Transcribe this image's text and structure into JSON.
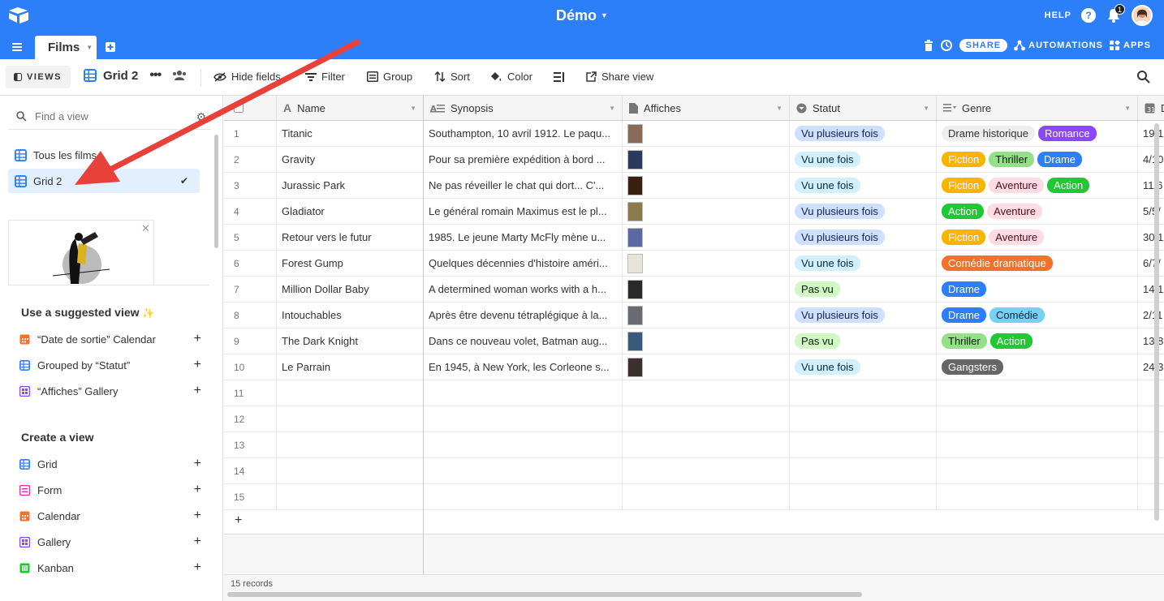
{
  "app": {
    "base_name": "Démo"
  },
  "top_right": {
    "help": "HELP",
    "help_icon": "?",
    "notif_count": "1"
  },
  "tabs": {
    "table_name": "Films",
    "share": "SHARE",
    "automations": "AUTOMATIONS",
    "apps": "APPS"
  },
  "toolbar": {
    "views": "VIEWS",
    "view_name": "Grid 2",
    "hide_fields": "Hide fields",
    "filter": "Filter",
    "group": "Group",
    "sort": "Sort",
    "color": "Color",
    "share_view": "Share view"
  },
  "sidebar": {
    "find_placeholder": "Find a view",
    "views": [
      {
        "label": "Tous les films"
      },
      {
        "label": "Grid 2"
      }
    ],
    "suggested_title": "Use a suggested view",
    "suggested": [
      {
        "label": "“Date de sortie” Calendar",
        "icon": "calendar-icon",
        "color": "#f2722c"
      },
      {
        "label": "Grouped by “Statut”",
        "icon": "grid-icon",
        "color": "#2d7ff9"
      },
      {
        "label": "“Affiches” Gallery",
        "icon": "gallery-icon",
        "color": "#8b46ff"
      }
    ],
    "create_title": "Create a view",
    "create": [
      {
        "label": "Grid",
        "icon": "grid-icon",
        "color": "#2d7ff9"
      },
      {
        "label": "Form",
        "icon": "form-icon",
        "color": "#e929ba"
      },
      {
        "label": "Calendar",
        "icon": "calendar-icon",
        "color": "#f2722c"
      },
      {
        "label": "Gallery",
        "icon": "gallery-icon",
        "color": "#8b46ff"
      },
      {
        "label": "Kanban",
        "icon": "kanban-icon",
        "color": "#20c933"
      }
    ]
  },
  "grid": {
    "headers": [
      "Name",
      "Synopsis",
      "Affiches",
      "Statut",
      "Genre",
      "D"
    ],
    "rows": [
      {
        "num": "1",
        "name": "Titanic",
        "synopsis": "Southampton, 10 avril 1912. Le paqu...",
        "statut": "Vu plusieurs fois",
        "genre": [
          "Drame historique",
          "Romance"
        ],
        "date": "19/1"
      },
      {
        "num": "2",
        "name": "Gravity",
        "synopsis": "Pour sa première expédition à bord ...",
        "statut": "Vu une fois",
        "genre": [
          "Fiction",
          "Thriller",
          "Drame"
        ],
        "date": "4/10"
      },
      {
        "num": "3",
        "name": "Jurassic Park",
        "synopsis": "Ne pas réveiller le chat qui dort... C'...",
        "statut": "Vu une fois",
        "genre": [
          "Fiction",
          "Aventure",
          "Action"
        ],
        "date": "11/6"
      },
      {
        "num": "4",
        "name": "Gladiator",
        "synopsis": "Le général romain Maximus est le pl...",
        "statut": "Vu plusieurs fois",
        "genre": [
          "Action",
          "Aventure"
        ],
        "date": "5/5/"
      },
      {
        "num": "5",
        "name": "Retour vers le futur",
        "synopsis": "1985. Le jeune Marty McFly mène u...",
        "statut": "Vu plusieurs fois",
        "genre": [
          "Fiction",
          "Aventure"
        ],
        "date": "30/1"
      },
      {
        "num": "6",
        "name": "Forest Gump",
        "synopsis": "Quelques décennies d'histoire améri...",
        "statut": "Vu une fois",
        "genre": [
          "Comédie dramatique"
        ],
        "date": "6/7/"
      },
      {
        "num": "7",
        "name": "Million Dollar Baby",
        "synopsis": "A determined woman works with a h...",
        "statut": "Pas vu",
        "genre": [
          "Drame"
        ],
        "date": "14/1"
      },
      {
        "num": "8",
        "name": "Intouchables",
        "synopsis": "Après être devenu tétraplégique à la...",
        "statut": "Vu plusieurs fois",
        "genre": [
          "Drame",
          "Comédie"
        ],
        "date": "2/11"
      },
      {
        "num": "9",
        "name": "The Dark Knight",
        "synopsis": "Dans ce nouveau volet, Batman aug...",
        "statut": "Pas vu",
        "genre": [
          "Thriller",
          "Action"
        ],
        "date": "13/8"
      },
      {
        "num": "10",
        "name": "Le Parrain",
        "synopsis": "En 1945, à New York, les Corleone s...",
        "statut": "Vu une fois",
        "genre": [
          "Gangsters"
        ],
        "date": "24/3"
      },
      {
        "num": "11"
      },
      {
        "num": "12"
      },
      {
        "num": "13"
      },
      {
        "num": "14"
      },
      {
        "num": "15"
      }
    ],
    "add_row": "+",
    "footer": "15 records"
  },
  "colors": {
    "statut": {
      "Vu plusieurs fois": [
        "#cfdfff",
        "#102046"
      ],
      "Vu une fois": [
        "#d0f0fd",
        "#04283f"
      ],
      "Pas vu": [
        "#d1f7c4",
        "#0b1d05"
      ]
    },
    "genre": {
      "Drame historique": [
        "#eeeeee",
        "#333333"
      ],
      "Romance": [
        "#8b46ff",
        "#ffffff"
      ],
      "Fiction": [
        "#fcb400",
        "#ffffff"
      ],
      "Thriller": [
        "#93e088",
        "#0b1d05"
      ],
      "Drame": [
        "#2d7ff9",
        "#ffffff"
      ],
      "Aventure": [
        "#ffdce5",
        "#4c0c1c"
      ],
      "Action": [
        "#20c933",
        "#ffffff"
      ],
      "Comédie dramatique": [
        "#f2722c",
        "#ffffff"
      ],
      "Comédie": [
        "#77d1f3",
        "#04283f"
      ],
      "Gangsters": [
        "#666666",
        "#ffffff"
      ]
    },
    "posters": [
      "#8a6a58",
      "#2a3a5a",
      "#3a2010",
      "#8c7a4a",
      "#5a6aa0",
      "#e8e4dc",
      "#2a2a2a",
      "#6a6a72",
      "#3a5a7a",
      "#3a3030"
    ]
  }
}
